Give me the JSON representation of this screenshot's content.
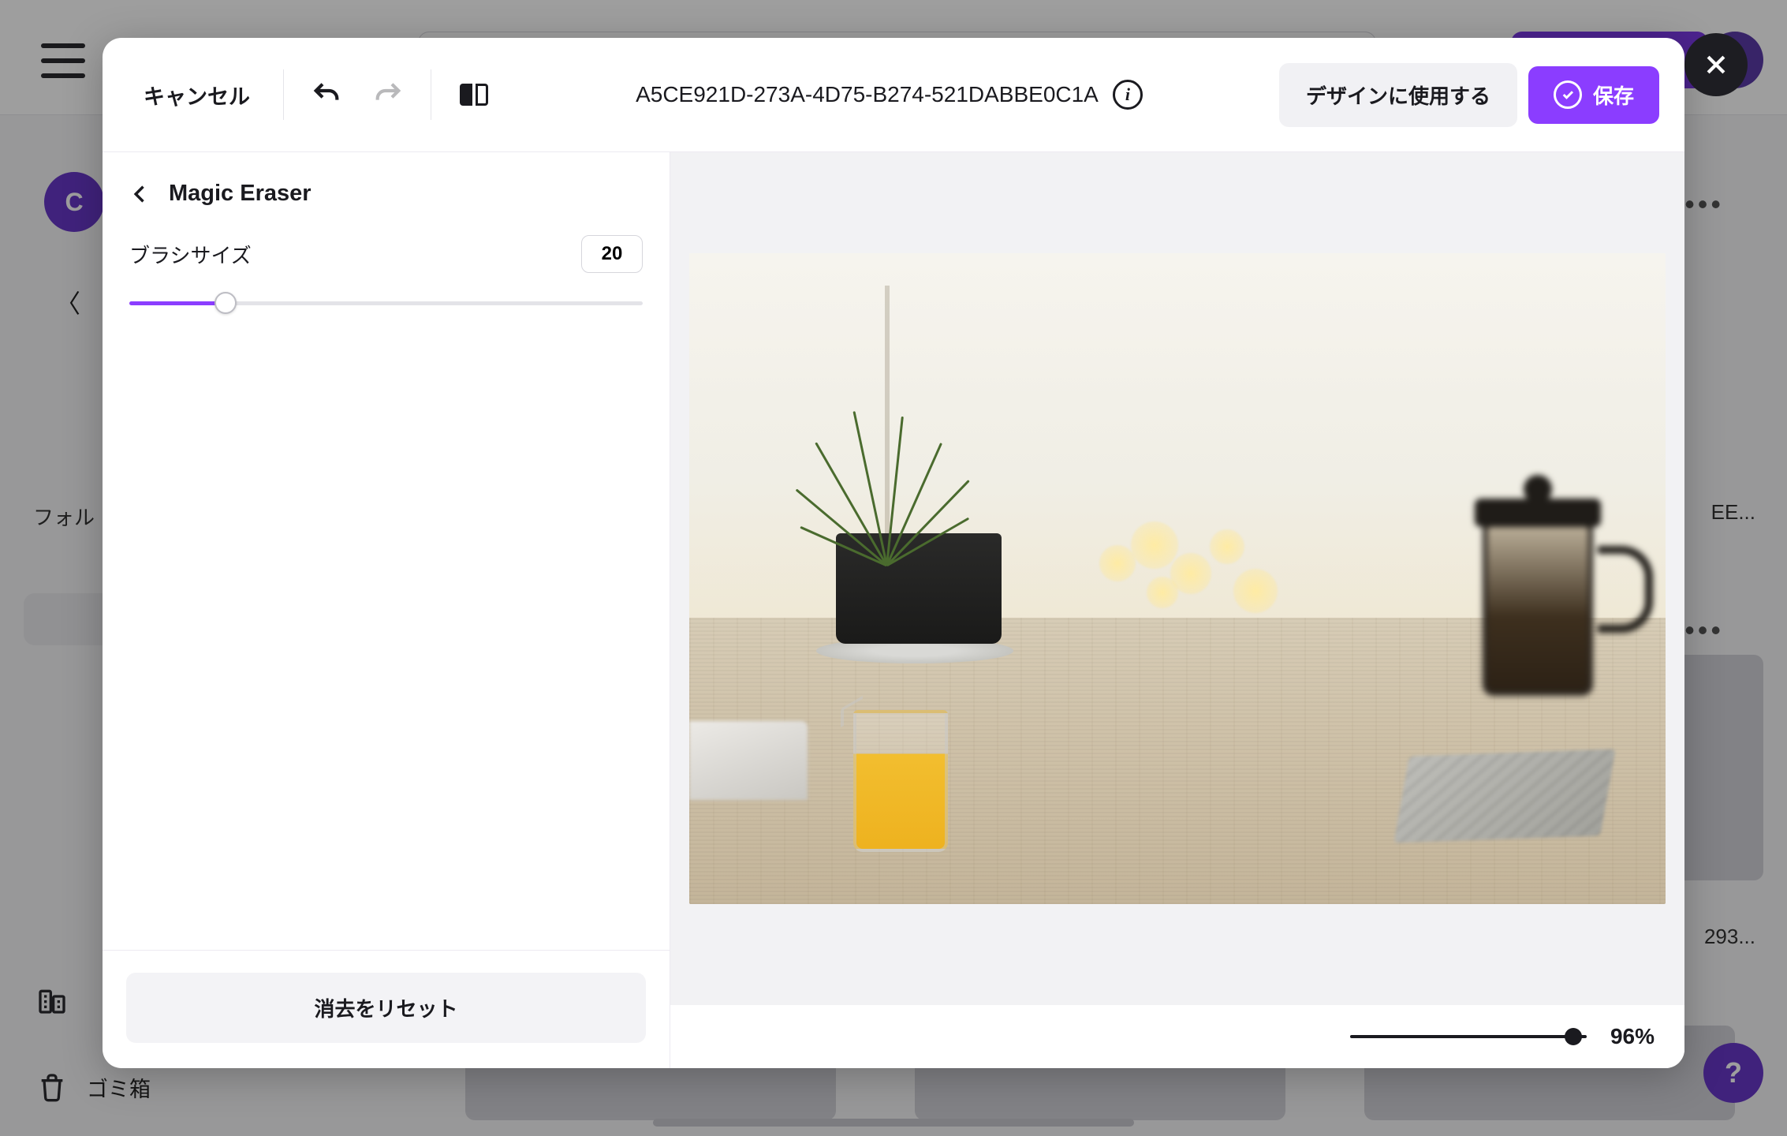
{
  "background": {
    "avatar_initial": "C",
    "folder_label_truncated": "フォル",
    "bottom_items": [
      {
        "icon": "building-icon",
        "label": ""
      },
      {
        "icon": "trash-icon",
        "label": "ゴミ箱"
      }
    ],
    "truncated_thumb_label_right_1": "EE...",
    "truncated_thumb_label_right_2": "293...",
    "help_badge": "?"
  },
  "modal": {
    "cancel": "キャンセル",
    "title": "A5CE921D-273A-4D75-B274-521DABBE0C1A",
    "use_in_design": "デザインに使用する",
    "save": "保存"
  },
  "panel": {
    "title": "Magic Eraser",
    "brush_label": "ブラシサイズ",
    "brush_value": "20",
    "reset": "消去をリセット"
  },
  "zoom": {
    "label": "96%"
  }
}
